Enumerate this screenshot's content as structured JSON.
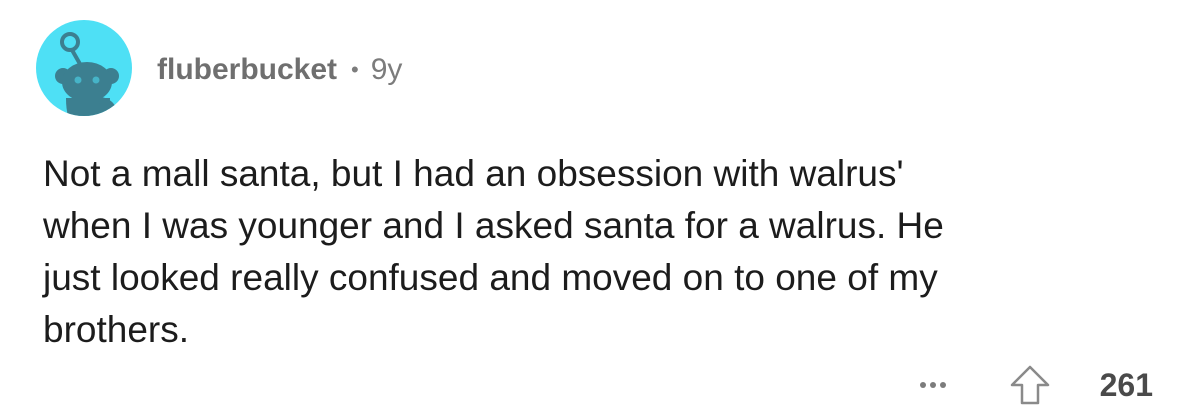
{
  "comment": {
    "author": "fluberbucket",
    "separator": "•",
    "age": "9y",
    "body": "Not a mall santa, but I had an obsession with walrus'\nwhen I was younger and I asked santa for a walrus. He\njust looked really confused and moved on to one of my\nbrothers.",
    "score": "261"
  },
  "icons": {
    "avatar": "reddit-snoo-avatar-icon",
    "more": "more-options-icon",
    "upvote": "upvote-arrow-icon"
  },
  "colors": {
    "avatar_background": "#4ee0f5",
    "avatar_figure": "#3c7f90",
    "meta_text": "#7c7c7c",
    "body_text": "#1c1c1c"
  }
}
